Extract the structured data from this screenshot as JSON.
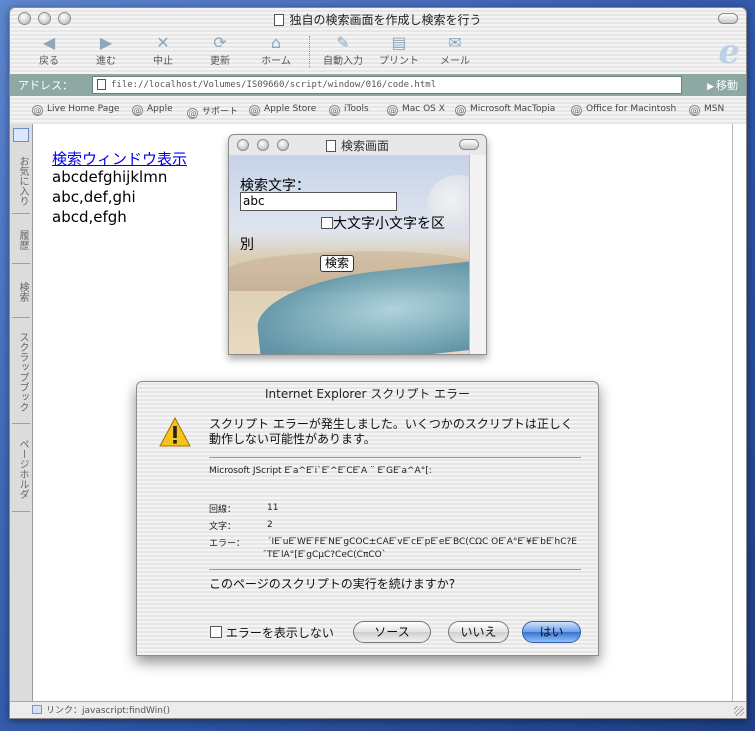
{
  "window": {
    "title": "独自の検索画面を作成し検索を行う"
  },
  "toolbar": {
    "back": "戻る",
    "forward": "進む",
    "stop": "中止",
    "refresh": "更新",
    "home": "ホーム",
    "autofill": "自動入力",
    "print": "プリント",
    "mail": "メール"
  },
  "address": {
    "label": "アドレス：",
    "url": "file://localhost/Volumes/IS09660/script/window/016/code.html",
    "go": "移動"
  },
  "favorites": [
    "Live Home Page",
    "Apple",
    "サポート",
    "Apple Store",
    "iTools",
    "Mac OS X",
    "Microsoft MacTopia",
    "Office for Macintosh",
    "MSN"
  ],
  "side_tabs": [
    "お気に入り",
    "履歴",
    "検索",
    "スクラップブック",
    "ページホルダ"
  ],
  "page": {
    "link": "検索ウィンドウ表示",
    "lines": [
      "abcdefghijklmn",
      "abc,def,ghi",
      "abcd,efgh"
    ]
  },
  "search_popup": {
    "title": "検索画面",
    "label": "検索文字：",
    "input_value": "abc",
    "checkbox_label_1": "大文字小文字を区",
    "checkbox_label_2": "別",
    "button": "検索"
  },
  "error_dialog": {
    "title": "Internet Explorer スクリプト エラー",
    "message": "スクリプト エラーが発生しました。いくつかのスクリプトは正しく動作しない可能性があります。",
    "engine_line": "Microsoft JScript E ̄a^E ̄i`E ̄^E ̄CE ̄A ¨ E ̄GE ̄a^A°[:",
    "line_label": "回線：",
    "line_value": "11",
    "char_label": "文字：",
    "char_value": "2",
    "error_label": "エラー：",
    "error_value": "´IE ̄uE ̄WE ̄FE ̄NE ̄gCOC±CAE ̄vE ̄cE ̄pE ̄eE ̄BC(CΩC OE ̄A°E ̄¥E ̄bE ̄hC?E ̄TE ̄lA°[E ̄gCμC?CeC(CπCO`",
    "question": "このページのスクリプトの実行を続けますか?",
    "suppress_label": "エラーを表示しない",
    "source_button": "ソース",
    "no_button": "いいえ",
    "yes_button": "はい"
  },
  "status": {
    "text": "リンク：javascript:findWin()"
  }
}
